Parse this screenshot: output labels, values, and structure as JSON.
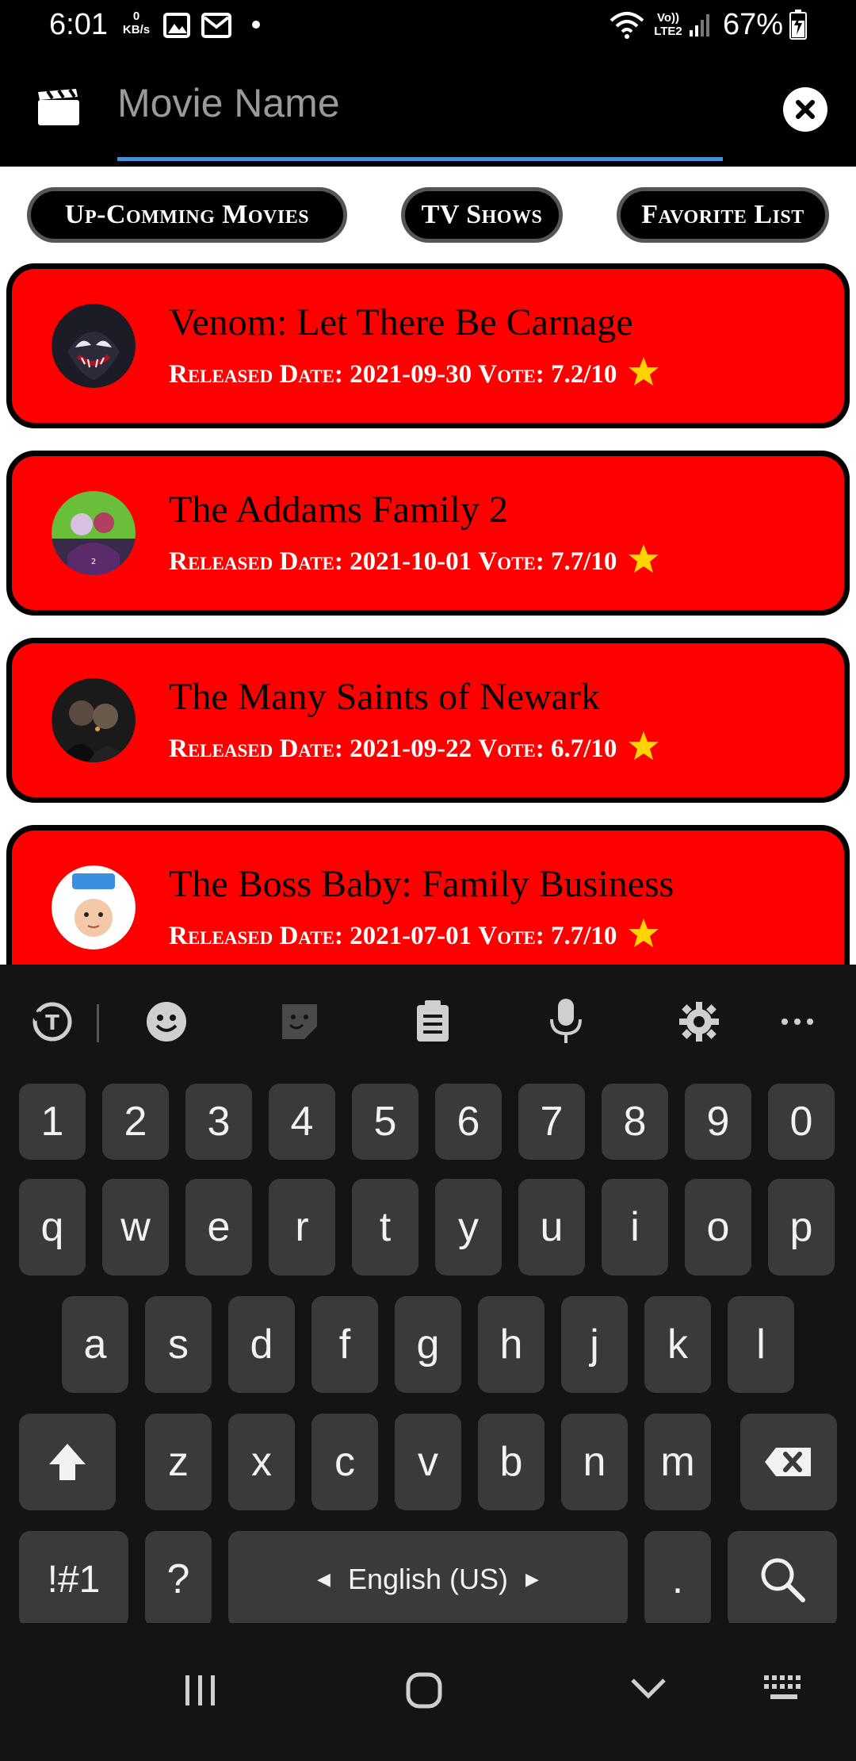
{
  "status_bar": {
    "time": "6:01",
    "kbs_value": "0",
    "kbs_unit": "KB/s",
    "volte": "Vo)) LTE2",
    "battery": "67%"
  },
  "search": {
    "placeholder": "Movie Name",
    "value": ""
  },
  "chips": [
    {
      "label": "Up-Comming Movies"
    },
    {
      "label": "TV Shows"
    },
    {
      "label": "Favorite List"
    }
  ],
  "movies": [
    {
      "title": "Venom: Let There Be Carnage",
      "released_label": "Released Date:",
      "released": "2021-09-30",
      "vote_label": "Vote:",
      "vote": "7.2/10",
      "poster_icon": "venom-poster"
    },
    {
      "title": "The Addams Family 2",
      "released_label": "Released Date:",
      "released": "2021-10-01",
      "vote_label": "Vote:",
      "vote": "7.7/10",
      "poster_icon": "addams-poster"
    },
    {
      "title": "The Many Saints of Newark",
      "released_label": "Released Date:",
      "released": "2021-09-22",
      "vote_label": "Vote:",
      "vote": "6.7/10",
      "poster_icon": "saints-poster"
    },
    {
      "title": "The Boss Baby: Family Business",
      "released_label": "Released Date:",
      "released": "2021-07-01",
      "vote_label": "Vote:",
      "vote": "7.7/10",
      "poster_icon": "boss-baby-poster"
    }
  ],
  "keyboard": {
    "numbers": [
      "1",
      "2",
      "3",
      "4",
      "5",
      "6",
      "7",
      "8",
      "9",
      "0"
    ],
    "row1": [
      "q",
      "w",
      "e",
      "r",
      "t",
      "y",
      "u",
      "i",
      "o",
      "p"
    ],
    "row2": [
      "a",
      "s",
      "d",
      "f",
      "g",
      "h",
      "j",
      "k",
      "l"
    ],
    "row3": [
      "z",
      "x",
      "c",
      "v",
      "b",
      "n",
      "m"
    ],
    "symbols_key": "!#1",
    "question_key": "?",
    "space_label": "English (US)",
    "period_key": "."
  },
  "colors": {
    "card_bg": "#ff0000",
    "accent_underline": "#4a90d9",
    "star": "#ffd400"
  }
}
